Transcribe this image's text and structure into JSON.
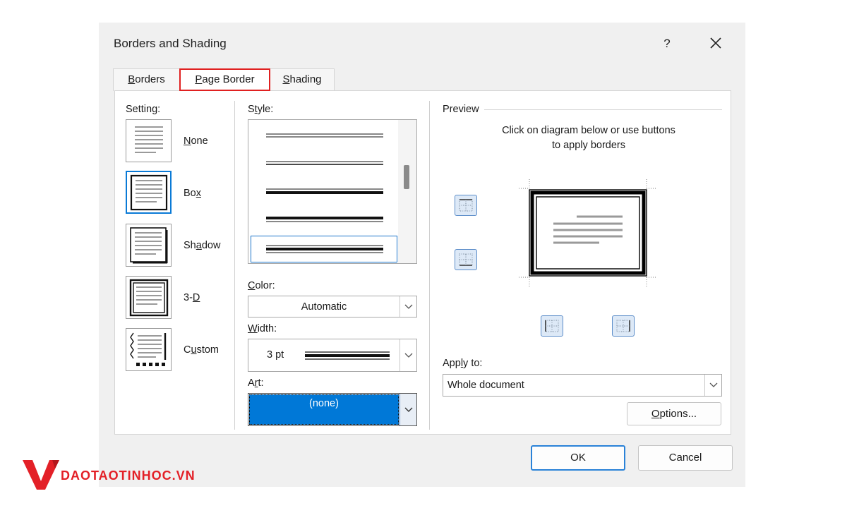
{
  "dialog": {
    "title": "Borders and Shading",
    "help": "?"
  },
  "tabs": [
    {
      "label_prefix": "",
      "label_mnemonic": "B",
      "label_rest": "orders",
      "active": false
    },
    {
      "label_prefix": "",
      "label_mnemonic": "P",
      "label_rest": "age Border",
      "active": true
    },
    {
      "label_prefix": "",
      "label_mnemonic": "S",
      "label_rest": "hading",
      "active": false
    }
  ],
  "setting": {
    "label": "Setting:",
    "options": [
      {
        "pre": "",
        "mn": "N",
        "post": "one",
        "selected": false
      },
      {
        "pre": "Bo",
        "mn": "x",
        "post": "",
        "selected": true
      },
      {
        "pre": "Sh",
        "mn": "a",
        "post": "dow",
        "selected": false
      },
      {
        "pre": "3-",
        "mn": "D",
        "post": "",
        "selected": false
      },
      {
        "pre": "C",
        "mn": "u",
        "post": "stom",
        "selected": false
      }
    ]
  },
  "style": {
    "label_pre": "S",
    "label_mn": "t",
    "label_post": "yle:",
    "selected_index": 4
  },
  "color": {
    "label_pre": "",
    "label_mn": "C",
    "label_post": "olor:",
    "value": "Automatic"
  },
  "width": {
    "label_pre": "",
    "label_mn": "W",
    "label_post": "idth:",
    "value": "3 pt"
  },
  "art": {
    "label_pre": "A",
    "label_mn": "r",
    "label_post": "t:",
    "value": "(none)"
  },
  "preview": {
    "label": "Preview",
    "instruction_line1": "Click on diagram below or use buttons",
    "instruction_line2": "to apply borders"
  },
  "apply_to": {
    "label_pre": "App",
    "label_mn": "l",
    "label_post": "y to:",
    "value": "Whole document"
  },
  "buttons": {
    "options_pre": "",
    "options_mn": "O",
    "options_post": "ptions...",
    "ok": "OK",
    "cancel": "Cancel"
  },
  "watermark": {
    "text": "DAOTAOTINHOC.VN"
  },
  "colors": {
    "accent_blue": "#0078d7",
    "highlight_red": "#e02020",
    "brand_red": "#e32027"
  }
}
